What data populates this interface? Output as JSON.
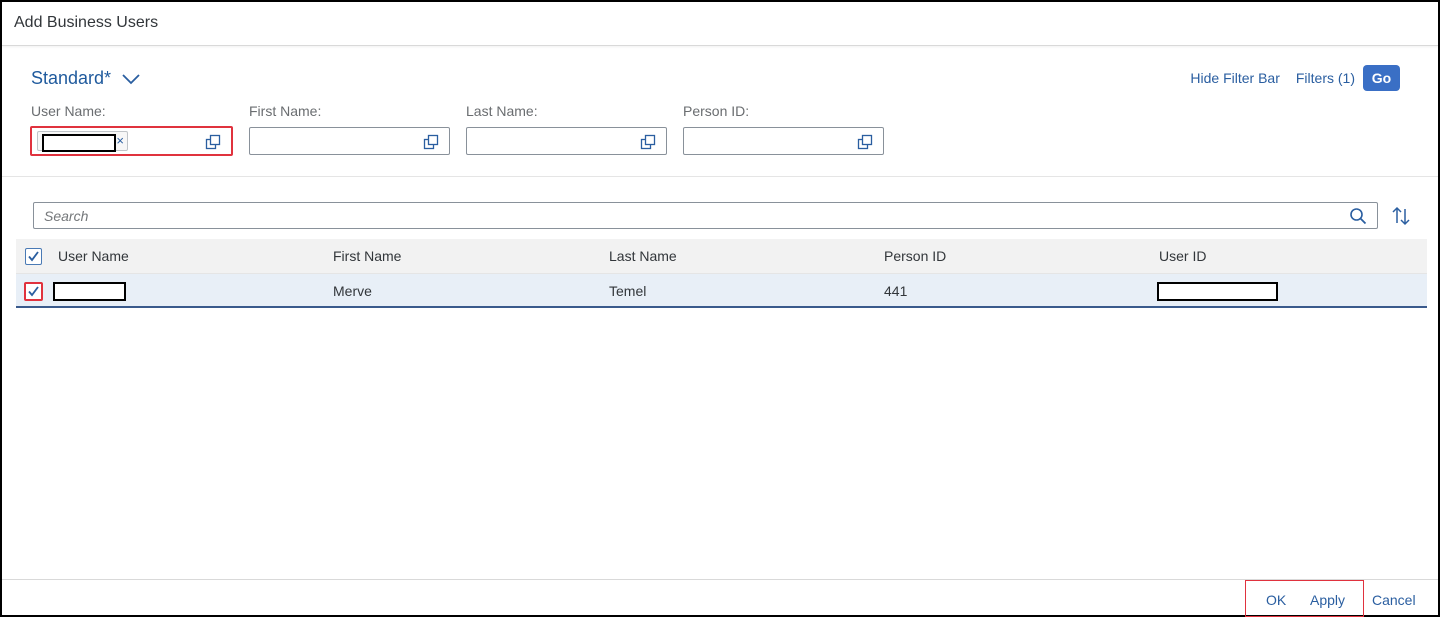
{
  "dialog": {
    "title": "Add Business Users"
  },
  "variant": {
    "name": "Standard*"
  },
  "filter_bar": {
    "hide_label": "Hide Filter Bar",
    "filters_label": "Filters (1)",
    "go_label": "Go",
    "fields": [
      {
        "label": "User Name:",
        "value": ""
      },
      {
        "label": "First Name:",
        "value": ""
      },
      {
        "label": "Last Name:",
        "value": ""
      },
      {
        "label": "Person ID:",
        "value": ""
      }
    ],
    "token_remove": "×"
  },
  "search": {
    "placeholder": "Search"
  },
  "table": {
    "columns": [
      "User Name",
      "First Name",
      "Last Name",
      "Person ID",
      "User ID"
    ],
    "rows": [
      {
        "user_name": "",
        "first_name": "Merve",
        "last_name": "Temel",
        "person_id": "441",
        "user_id": "",
        "selected": true
      }
    ]
  },
  "footer": {
    "ok": "OK",
    "apply": "Apply",
    "cancel": "Cancel"
  },
  "colors": {
    "accent": "#3a6fc5",
    "link": "#2a5ea0",
    "highlight": "#e0323e",
    "row_selected": "#e8eff7"
  }
}
